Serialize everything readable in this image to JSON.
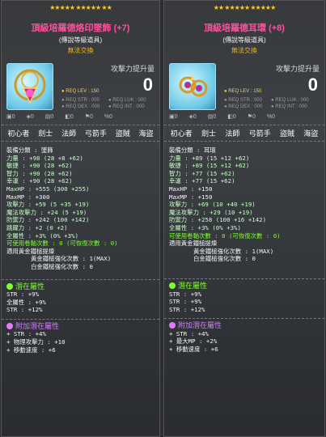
{
  "left": {
    "stars": "★★★★★ ★★★★★ ★★",
    "stars_off": "★★★★★ ★★★★★ ★★★★",
    "name": "頂級培羅德烙印墜飾 (+7)",
    "grade": "(傳說等級道具)",
    "trade": "無法交換",
    "power_label": "攻擊力提升量",
    "power_value": "0",
    "req_lev": "● REQ LEV : 150",
    "req_str": "● REQ STR : 000",
    "req_luk": "● REQ LUK : 000",
    "req_dex": "● REQ DEX : 000",
    "req_int": "● REQ INT : 000",
    "icons": [
      "0",
      "0",
      "0",
      "0",
      "0",
      "0",
      "0"
    ],
    "jobs": [
      "初心者",
      "劍士",
      "法師",
      "弓箭手",
      "盜賊",
      "海盜"
    ],
    "lines": [
      "裝備分類 : 墜飾",
      "力量 : +98 (28 +8 +62)",
      "敏捷 : +90 (28 +62)",
      "智力 : +90 (28 +62)",
      "幸運 : +90 (28 +62)",
      "MaxHP : +555 (300 +255)",
      "MaxMP : +300",
      "攻擊力 : +59 (5 +35 +19)",
      "魔法攻擊力 : +24 (5 +19)",
      "防禦力 : +242 (100 +142)",
      "跳躍力 : +2 (0 +2)",
      "全屬性 : +3% (0% +3%)",
      "可使用卷軸次數 : 0 (可恢復次數 : 0)",
      "適用黃金鐵槌提煉",
      "黃金鐵槌強化次數 : 1(MAX)",
      "白金鐵槌強化次數 : 0"
    ],
    "potential_title": "潛在屬性",
    "potential": [
      "STR : +9%",
      "全屬性 : +9%",
      "STR : +12%"
    ],
    "bonus_title": "附加潛在屬性",
    "bonus": [
      "+ STR : +4%",
      "+ 物理攻擊力 : +10",
      "+ 移動速度 : +6"
    ]
  },
  "right": {
    "stars": "★★ ★★★★★ ★★★★★",
    "stars_off": "★★★★★ ★★★★★ ★★★★",
    "name": "頂級培羅德耳環 (+8)",
    "grade": "(傳說等級道具)",
    "trade": "無法交換",
    "power_label": "攻擊力提升量",
    "power_value": "0",
    "req_lev": "● REQ LEV : 150",
    "req_str": "● REQ STR : 000",
    "req_luk": "● REQ LUK : 000",
    "req_dex": "● REQ DEX : 000",
    "req_int": "● REQ INT : 000",
    "icons": [
      "0",
      "0",
      "0",
      "0",
      "0",
      "0",
      "0"
    ],
    "jobs": [
      "初心者",
      "劍士",
      "法師",
      "弓箭手",
      "盜賊",
      "海盜"
    ],
    "lines": [
      "裝備分類 : 耳環",
      "力量 : +89 (15 +12 +62)",
      "敏捷 : +89 (15 +12 +62)",
      "智力 : +77 (15 +62)",
      "幸運 : +77 (15 +62)",
      "MaxHP : +150",
      "MaxMP : +150",
      "攻擊力 : +69 (10 +40 +19)",
      "魔法攻擊力 : +29 (10 +19)",
      "防禦力 : +258 (100 +16 +142)",
      "全屬性 : +3% (0% +3%)",
      "可使用卷軸次數 : 0 (可恢復次數 : 0)",
      "適用黃金鐵槌提煉",
      "黃金鐵槌強化次數 : 1(MAX)",
      "白金鐵槌強化次數 : 0"
    ],
    "potential_title": "潛在屬性",
    "potential": [
      "STR : +9%",
      "STR : +9%",
      "STR : +12%"
    ],
    "bonus_title": "附加潛在屬性",
    "bonus": [
      "+ STR : +4%",
      "+ 最大MP : +2%",
      "+ 移動速度 : +6"
    ]
  }
}
